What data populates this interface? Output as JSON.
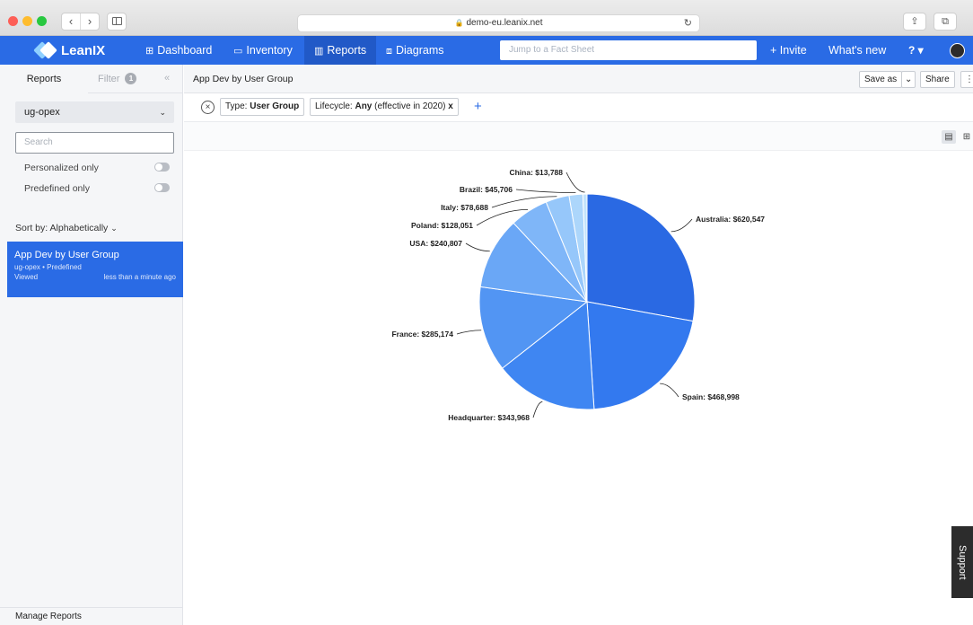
{
  "browser": {
    "url": "demo-eu.leanix.net"
  },
  "nav": {
    "brand": "LeanIX",
    "items": [
      {
        "label": "Dashboard",
        "icon": "grid-icon"
      },
      {
        "label": "Inventory",
        "icon": "inventory-icon"
      },
      {
        "label": "Reports",
        "icon": "bar-chart-icon"
      },
      {
        "label": "Diagrams",
        "icon": "diagram-icon"
      }
    ],
    "search_placeholder": "Jump to a Fact Sheet",
    "invite": "+ Invite",
    "whats_new": "What's new",
    "help": "? ▾"
  },
  "sidebar": {
    "tabs": {
      "reports": "Reports",
      "filter": "Filter",
      "filter_count": "1",
      "collapse": "«"
    },
    "group_select": "ug-opex",
    "search_placeholder": "Search",
    "toggles": [
      {
        "label": "Personalized only",
        "on": false
      },
      {
        "label": "Predefined only",
        "on": false
      }
    ],
    "sort_by": "Sort by: Alphabetically",
    "report": {
      "name": "App Dev by User Group",
      "meta": "ug-opex • Predefined",
      "viewed_label": "Viewed",
      "viewed_time": "less than a minute ago"
    },
    "manage": "Manage Reports"
  },
  "main": {
    "title": "App Dev by User Group",
    "save_as": "Save as",
    "share": "Share",
    "filters": {
      "type_prefix": "Type: ",
      "type_value": "User Group",
      "lifecycle_prefix": "Lifecycle: ",
      "lifecycle_value": "Any",
      "lifecycle_suffix": " (effective in 2020)",
      "remove": "x",
      "add": "+"
    }
  },
  "support": "Support",
  "chart_data": {
    "type": "pie",
    "slices": [
      {
        "label": "Australia",
        "value": 620547,
        "display": "Australia: $620,547",
        "color": "#2a69e3"
      },
      {
        "label": "Spain",
        "value": 468998,
        "display": "Spain: $468,998",
        "color": "#3379ef"
      },
      {
        "label": "Headquarter",
        "value": 343968,
        "display": "Headquarter: $343,968",
        "color": "#3f86f2"
      },
      {
        "label": "France",
        "value": 285174,
        "display": "France: $285,174",
        "color": "#5295f3"
      },
      {
        "label": "USA",
        "value": 240807,
        "display": "USA: $240,807",
        "color": "#6aa7f6"
      },
      {
        "label": "Poland",
        "value": 128051,
        "display": "Poland: $128,051",
        "color": "#7fb6f8"
      },
      {
        "label": "Italy",
        "value": 78688,
        "display": "Italy: $78,688",
        "color": "#96c7fa"
      },
      {
        "label": "Brazil",
        "value": 45706,
        "display": "Brazil: $45,706",
        "color": "#acd6fb"
      },
      {
        "label": "China",
        "value": 13788,
        "display": "China: $13,788",
        "color": "#c2e3fc"
      }
    ]
  }
}
